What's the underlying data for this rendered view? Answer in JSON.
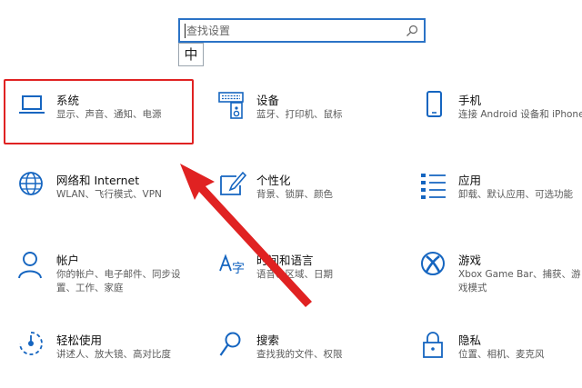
{
  "search": {
    "placeholder": "查找设置"
  },
  "ime": {
    "label": "中"
  },
  "colors": {
    "accent": "#2b73c6",
    "annotation": "#e02222"
  },
  "tiles": [
    {
      "title": "系统",
      "desc": "显示、声音、通知、电源",
      "icon": "laptop-icon"
    },
    {
      "title": "设备",
      "desc": "蓝牙、打印机、鼠标",
      "icon": "devices-icon"
    },
    {
      "title": "手机",
      "desc": "连接 Android 设备和 iPhone",
      "icon": "phone-icon"
    },
    {
      "title": "网络和 Internet",
      "desc": "WLAN、飞行模式、VPN",
      "icon": "globe-icon"
    },
    {
      "title": "个性化",
      "desc": "背景、锁屏、颜色",
      "icon": "paint-icon"
    },
    {
      "title": "应用",
      "desc": "卸载、默认应用、可选功能",
      "icon": "apps-list-icon"
    },
    {
      "title": "帐户",
      "desc": "你的帐户、电子邮件、同步设置、工作、家庭",
      "icon": "person-icon"
    },
    {
      "title": "时间和语言",
      "desc": "语音、区域、日期",
      "icon": "language-icon"
    },
    {
      "title": "游戏",
      "desc": "Xbox Game Bar、捕获、游戏模式",
      "icon": "xbox-icon"
    },
    {
      "title": "轻松使用",
      "desc": "讲述人、放大镜、高对比度",
      "icon": "accessibility-icon"
    },
    {
      "title": "搜索",
      "desc": "查找我的文件、权限",
      "icon": "search-icon"
    },
    {
      "title": "隐私",
      "desc": "位置、相机、麦克风",
      "icon": "lock-icon"
    }
  ]
}
